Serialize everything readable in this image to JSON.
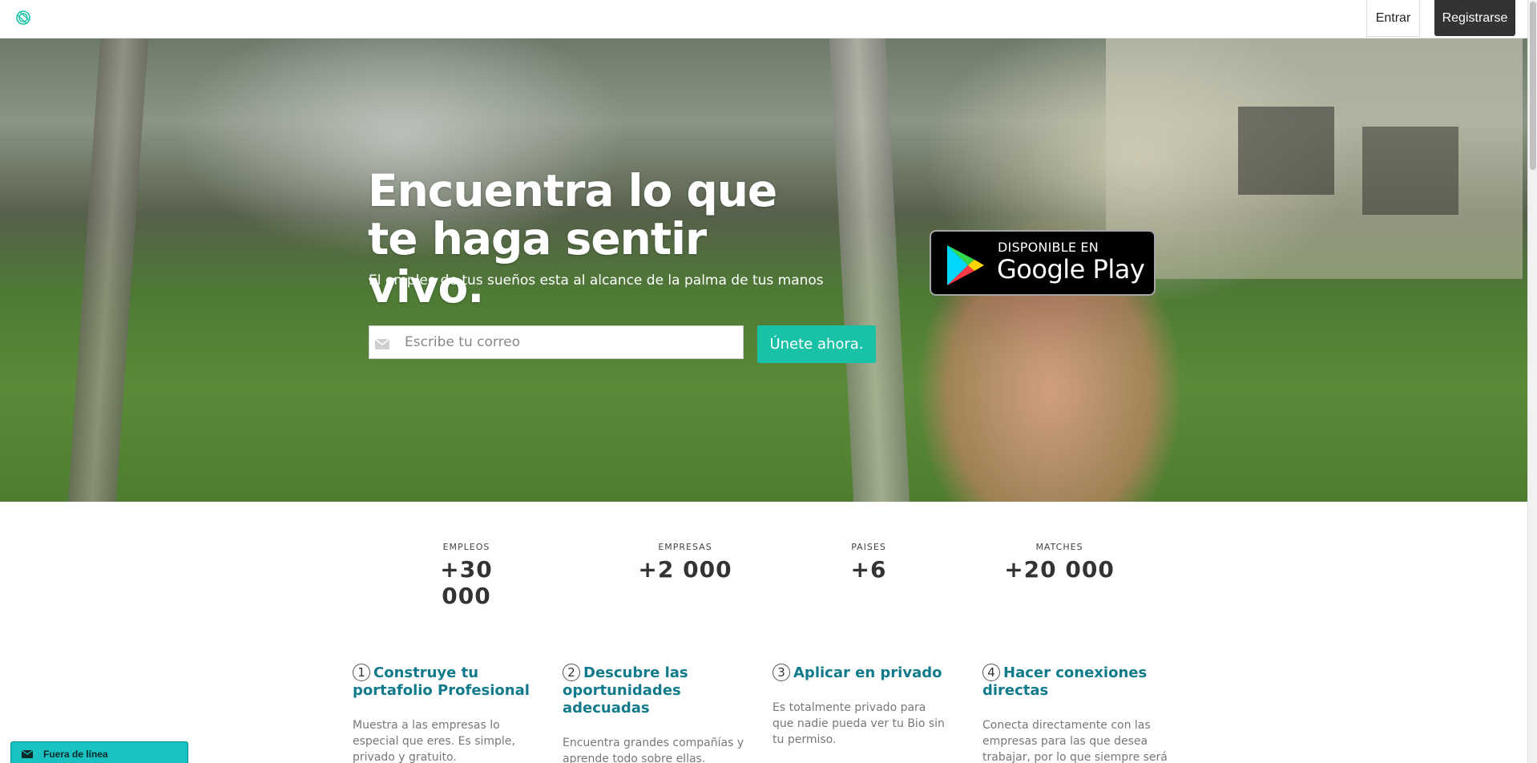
{
  "nav": {
    "logo_icon": "spiral-logo-icon",
    "login_label": "Entrar",
    "register_label": "Registrarse"
  },
  "hero": {
    "title": "Encuentra lo que te haga sentir vivo.",
    "subtitle": "El empleo de tus sueños esta al alcance de la palma de tus manos",
    "email_placeholder": "Escribe tu correo",
    "email_icon": "envelope-icon",
    "join_label": "Únete ahora.",
    "google_play": {
      "top_text": "DISPONIBLE EN",
      "main_text": "Google Play",
      "icon": "google-play-icon"
    }
  },
  "stats": [
    {
      "label": "EMPLEOS",
      "value": "+30 000"
    },
    {
      "label": "EMPRESAS",
      "value": "+2 000"
    },
    {
      "label": "PAISES",
      "value": "+6"
    },
    {
      "label": "MATCHES",
      "value": "+20 000"
    }
  ],
  "steps": [
    {
      "num": "1",
      "title": "Construye tu portafolio Profesional",
      "desc": "Muestra a las empresas lo especial que eres. Es simple, privado y gratuito."
    },
    {
      "num": "2",
      "title": "Descubre las oportunidades adecuadas",
      "desc": "Encuentra grandes compañías y aprende todo sobre ellas."
    },
    {
      "num": "3",
      "title": "Aplicar en privado",
      "desc": "Es totalmente privado para que nadie pueda ver tu Bio sin tu permiso."
    },
    {
      "num": "4",
      "title": "Hacer conexiones directas",
      "desc": "Conecta directamente con las empresas para las que desea trabajar, por lo que siempre será el"
    }
  ],
  "chat": {
    "label": "Fuera de línea",
    "icon": "envelope-icon"
  },
  "colors": {
    "accent": "#19c1a6",
    "step_title": "#117a8b",
    "dark_button": "#333333"
  }
}
